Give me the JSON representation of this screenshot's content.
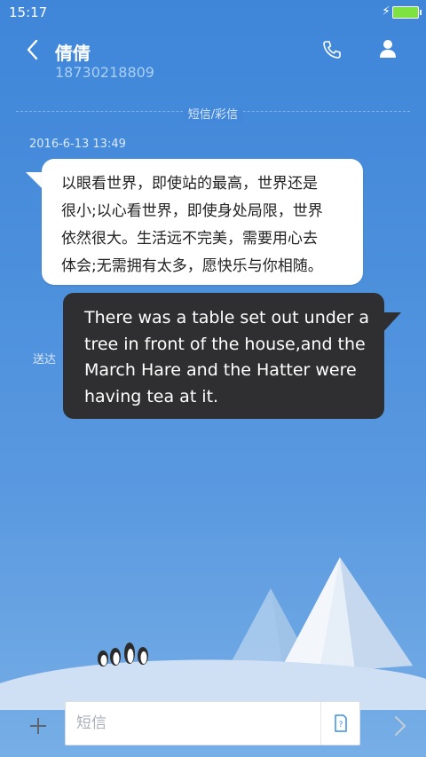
{
  "status_bar": {
    "time": "15:17"
  },
  "header": {
    "contact_name": "倩倩",
    "contact_phone": "18730218809"
  },
  "conversation": {
    "type_label": "短信/彩信",
    "timestamp": "2016-6-13 13:49",
    "incoming": {
      "lines": [
        "以眼看世界，即使站的最高，世界还是",
        "很小;以心看世界，即使身处局限，世界",
        "依然很大。生活远不完美，需要用心去",
        "体会;无需拥有太多，愿快乐与你相随。"
      ]
    },
    "outgoing": {
      "lines": [
        "There was a table set out under a",
        "tree in front of the house,and the",
        "March Hare and the Hatter were",
        "having tea at it."
      ],
      "status": "送达"
    }
  },
  "input": {
    "placeholder": "短信"
  },
  "colors": {
    "background": "#4b8fdc",
    "outgoing_bubble": "#2f2f31",
    "incoming_bubble": "#ffffff",
    "battery": "#7ee342"
  }
}
